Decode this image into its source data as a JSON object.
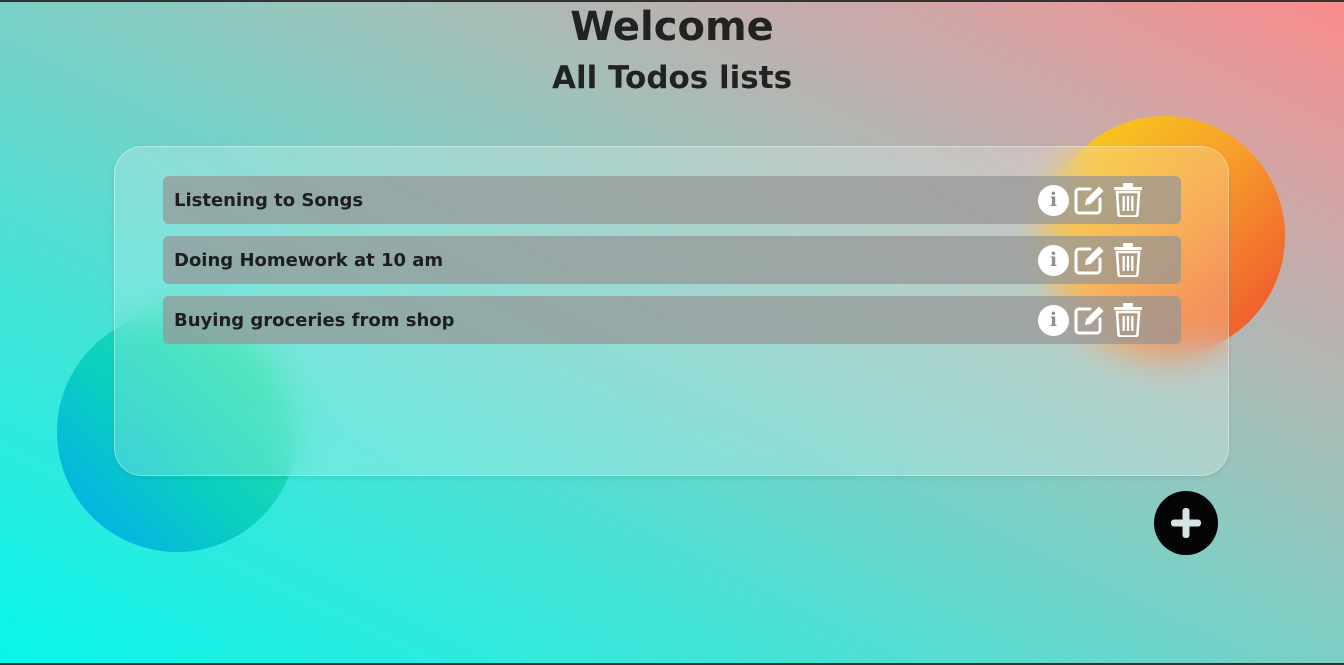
{
  "header": {
    "title": "Welcome",
    "subtitle": "All Todos lists"
  },
  "todos": [
    {
      "text": "Listening to Songs"
    },
    {
      "text": "Doing Homework at 10 am"
    },
    {
      "text": "Buying groceries from shop"
    }
  ],
  "icons": {
    "info": "info-icon",
    "edit": "edit-icon",
    "delete": "trash-icon",
    "add": "plus-icon"
  },
  "colors": {
    "background_start": "#08f7ea",
    "background_end": "#fc8c8c",
    "row": "#969696",
    "add_button": "#050505"
  }
}
